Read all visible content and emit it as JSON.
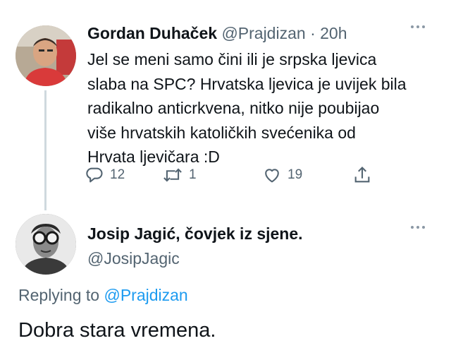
{
  "tweet_1": {
    "display_name": "Gordan Duhaček",
    "handle": "@Prajdizan",
    "separator": "·",
    "time": "20h",
    "text_lines": [
      "Jel se meni samo čini ili je srpska ljevica",
      "slaba na SPC? Hrvatska ljevica je uvijek bila",
      "radikalno anticrkvena, nitko nije poubijao",
      "više hrvatskih katoličkih svećenika od",
      "Hrvata ljevičara :D"
    ],
    "actions": {
      "reply": {
        "icon": "reply-icon",
        "count": "12"
      },
      "retweet": {
        "icon": "retweet-icon",
        "count": "1"
      },
      "like": {
        "icon": "heart-icon",
        "count": "19"
      },
      "share": {
        "icon": "share-icon"
      }
    }
  },
  "tweet_2": {
    "display_name": "Josip Jagić, čovjek iz sjene.",
    "handle": "@JosipJagic",
    "replying_prefix": "Replying to",
    "replying_handle": "@Prajdizan",
    "text": "Dobra stara vremena."
  },
  "colors": {
    "text": "#0f1419",
    "secondary": "#536471",
    "link": "#1d9bf0",
    "thread_line": "#cfd9de"
  }
}
